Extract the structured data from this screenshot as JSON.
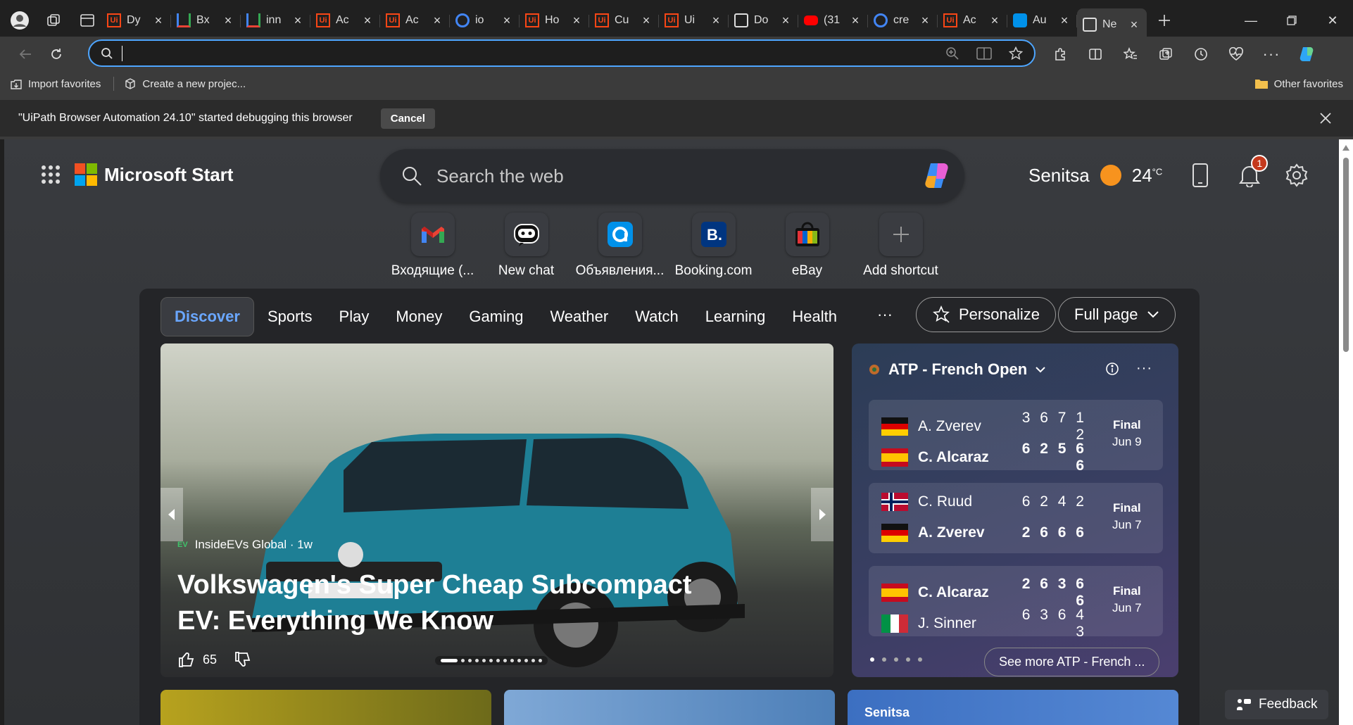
{
  "tabs": [
    {
      "title": "Dy",
      "icon": "uipath-icon"
    },
    {
      "title": "Bx",
      "icon": "gmail-icon"
    },
    {
      "title": "inn",
      "icon": "gmail-icon"
    },
    {
      "title": "Ac",
      "icon": "uipath-icon"
    },
    {
      "title": "Ac",
      "icon": "uipath-icon"
    },
    {
      "title": "io",
      "icon": "google-icon"
    },
    {
      "title": "Ho",
      "icon": "uipath-icon"
    },
    {
      "title": "Cu",
      "icon": "uipath-icon"
    },
    {
      "title": "Ui",
      "icon": "uipath-icon"
    },
    {
      "title": "Do",
      "icon": "document-icon"
    },
    {
      "title": "(31",
      "icon": "youtube-icon"
    },
    {
      "title": "cre",
      "icon": "google-icon"
    },
    {
      "title": "Ac",
      "icon": "uipath-icon"
    },
    {
      "title": "Au",
      "icon": "avito-icon"
    },
    {
      "title": "Ne",
      "icon": "newtab-icon"
    }
  ],
  "address": {
    "value": ""
  },
  "favorites": {
    "import": "Import favorites",
    "project": "Create a new projec...",
    "other": "Other favorites"
  },
  "debug": {
    "message": "\"UiPath Browser Automation 24.10\" started debugging this browser",
    "cancel": "Cancel"
  },
  "start": {
    "brand": "Microsoft Start",
    "search_placeholder": "Search the web",
    "location": "Senitsa",
    "temp": "24",
    "temp_unit": "°C",
    "notifications": "1"
  },
  "shortcuts": [
    {
      "label": "Входящие (..."
    },
    {
      "label": "New chat"
    },
    {
      "label": "Объявления..."
    },
    {
      "label": "Booking.com"
    },
    {
      "label": "eBay"
    },
    {
      "label": "Add shortcut"
    }
  ],
  "nav": {
    "tabs": [
      "Discover",
      "Sports",
      "Play",
      "Money",
      "Gaming",
      "Weather",
      "Watch",
      "Learning",
      "Health"
    ],
    "more": "···",
    "personalize": "Personalize",
    "fullpage": "Full page"
  },
  "hero": {
    "source": "InsideEVs Global · 1w",
    "title": "Volkswagen's Super Cheap Subcompact EV: Everything We Know",
    "likes": "65",
    "slide_count": 13,
    "active_slide": 1
  },
  "sports": {
    "title": "ATP - French Open",
    "see_more": "See more ATP - French ...",
    "matches": [
      {
        "p1": "A. Zverev",
        "s1": "3 6 7 1 2",
        "p2": "C. Alcaraz",
        "s2": "6 2 5 6 6",
        "winner": 2,
        "status": "Final",
        "date": "Jun 9"
      },
      {
        "p1": "C. Ruud",
        "s1": "6 2 4 2",
        "p2": "A. Zverev",
        "s2": "2 6 6 6",
        "winner": 2,
        "status": "Final",
        "date": "Jun 7"
      },
      {
        "p1": "C. Alcaraz",
        "s1": "2 6 3 6 6",
        "p2": "J. Sinner",
        "s2": "6 3 6 4 3",
        "winner": 1,
        "status": "Final",
        "date": "Jun 7"
      }
    ]
  },
  "partial": {
    "location": "Senitsa"
  },
  "feedback": "Feedback",
  "colors": {
    "accent": "#4ea6ff",
    "link": "#6aa7ff",
    "uipath": "#fa4616"
  }
}
